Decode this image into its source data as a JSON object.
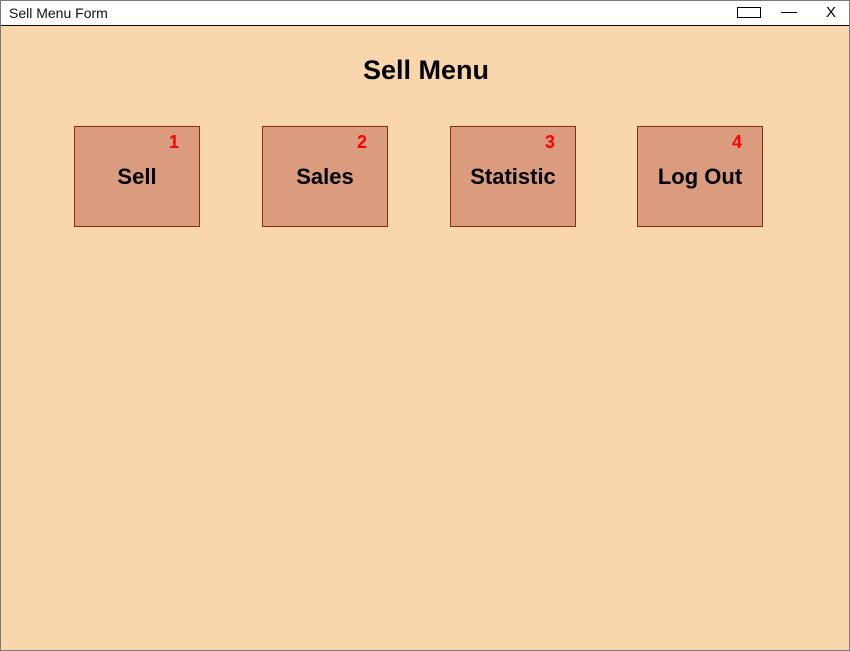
{
  "window": {
    "title": "Sell Menu Form",
    "close_label": "X",
    "background_color": "#f9d6ac",
    "titlebar_color": "#ffffff"
  },
  "page": {
    "title": "Sell Menu"
  },
  "menu": {
    "button_color": "#db9b7e",
    "button_border_color": "#8a2d12",
    "number_color": "#ff0000",
    "items": [
      {
        "label": "Sell",
        "number": "1"
      },
      {
        "label": "Sales",
        "number": "2"
      },
      {
        "label": "Statistic",
        "number": "3"
      },
      {
        "label": "Log Out",
        "number": "4"
      }
    ]
  },
  "icons": {
    "maximize": "maximize-icon",
    "minimize": "minimize-icon",
    "close": "close-icon"
  }
}
